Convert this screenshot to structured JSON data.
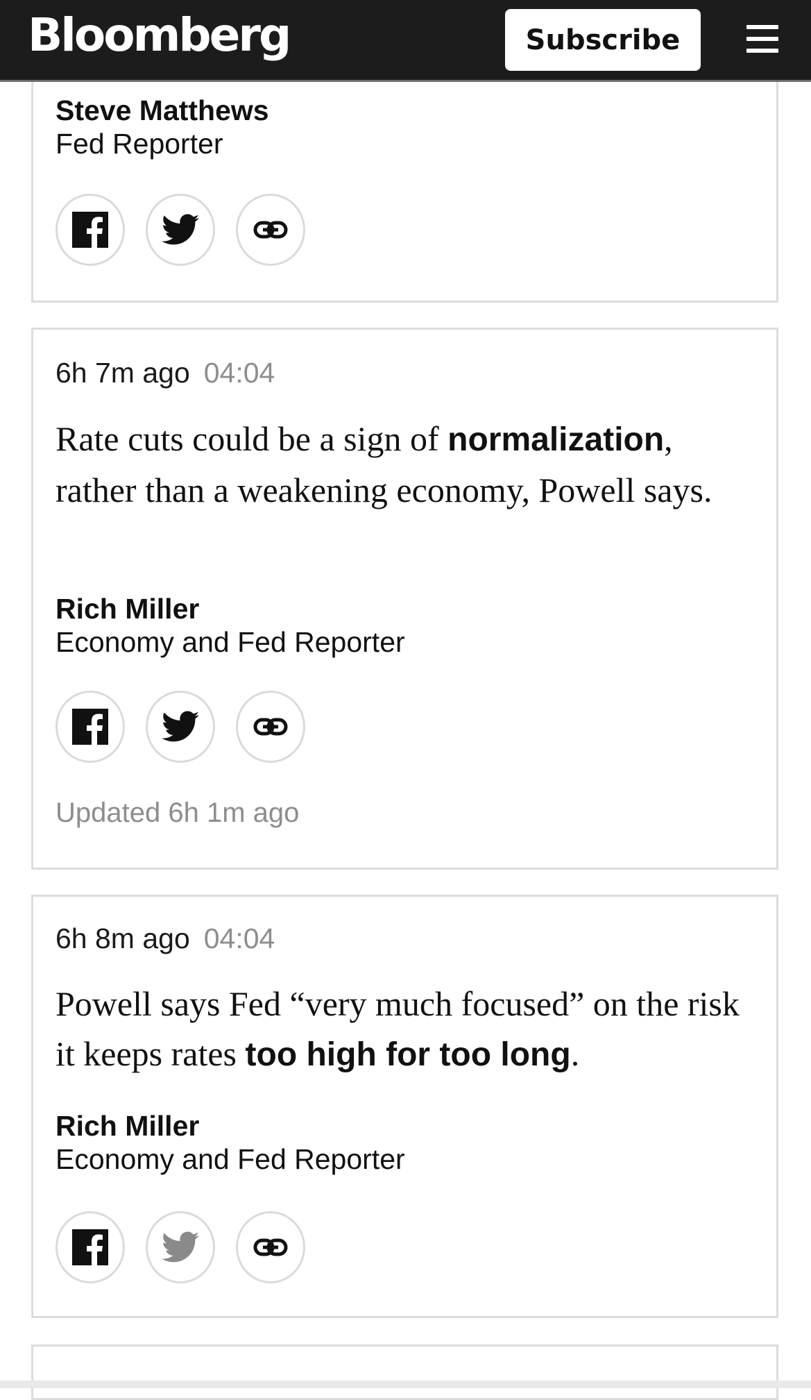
{
  "header": {
    "logo": "Bloomberg",
    "subscribe_label": "Subscribe",
    "menu_icon": "hamburger-menu-icon",
    "background": "#1c1c1c"
  },
  "posts": [
    {
      "author_name": "Steve Matthews",
      "author_role": "Fed Reporter",
      "share_icons": [
        "facebook-icon",
        "twitter-icon",
        "link-icon"
      ]
    },
    {
      "time_ago": "6h 7m ago",
      "clock": "04:04",
      "headline_before": "Rate cuts could be a sign of ",
      "headline_bold": "normalization",
      "headline_after": ", rather than a weakening economy, Powell says.",
      "author_name": "Rich Miller",
      "author_role": "Economy and Fed Reporter",
      "updated": "Updated 6h 1m ago",
      "share_icons": [
        "facebook-icon",
        "twitter-icon",
        "link-icon"
      ]
    },
    {
      "time_ago": "6h 8m ago",
      "clock": "04:04",
      "headline_before": "Powell says Fed “very much focused” on the risk it keeps rates ",
      "headline_bold": "too high for too long",
      "headline_after": ".",
      "author_name": "Rich Miller",
      "author_role": "Economy and Fed Reporter",
      "share_icons": [
        "facebook-icon",
        "twitter-icon",
        "link-icon"
      ]
    }
  ],
  "colors": {
    "timestamp_gray": "#8d8d8d",
    "border_gray": "#dcdcdc"
  }
}
